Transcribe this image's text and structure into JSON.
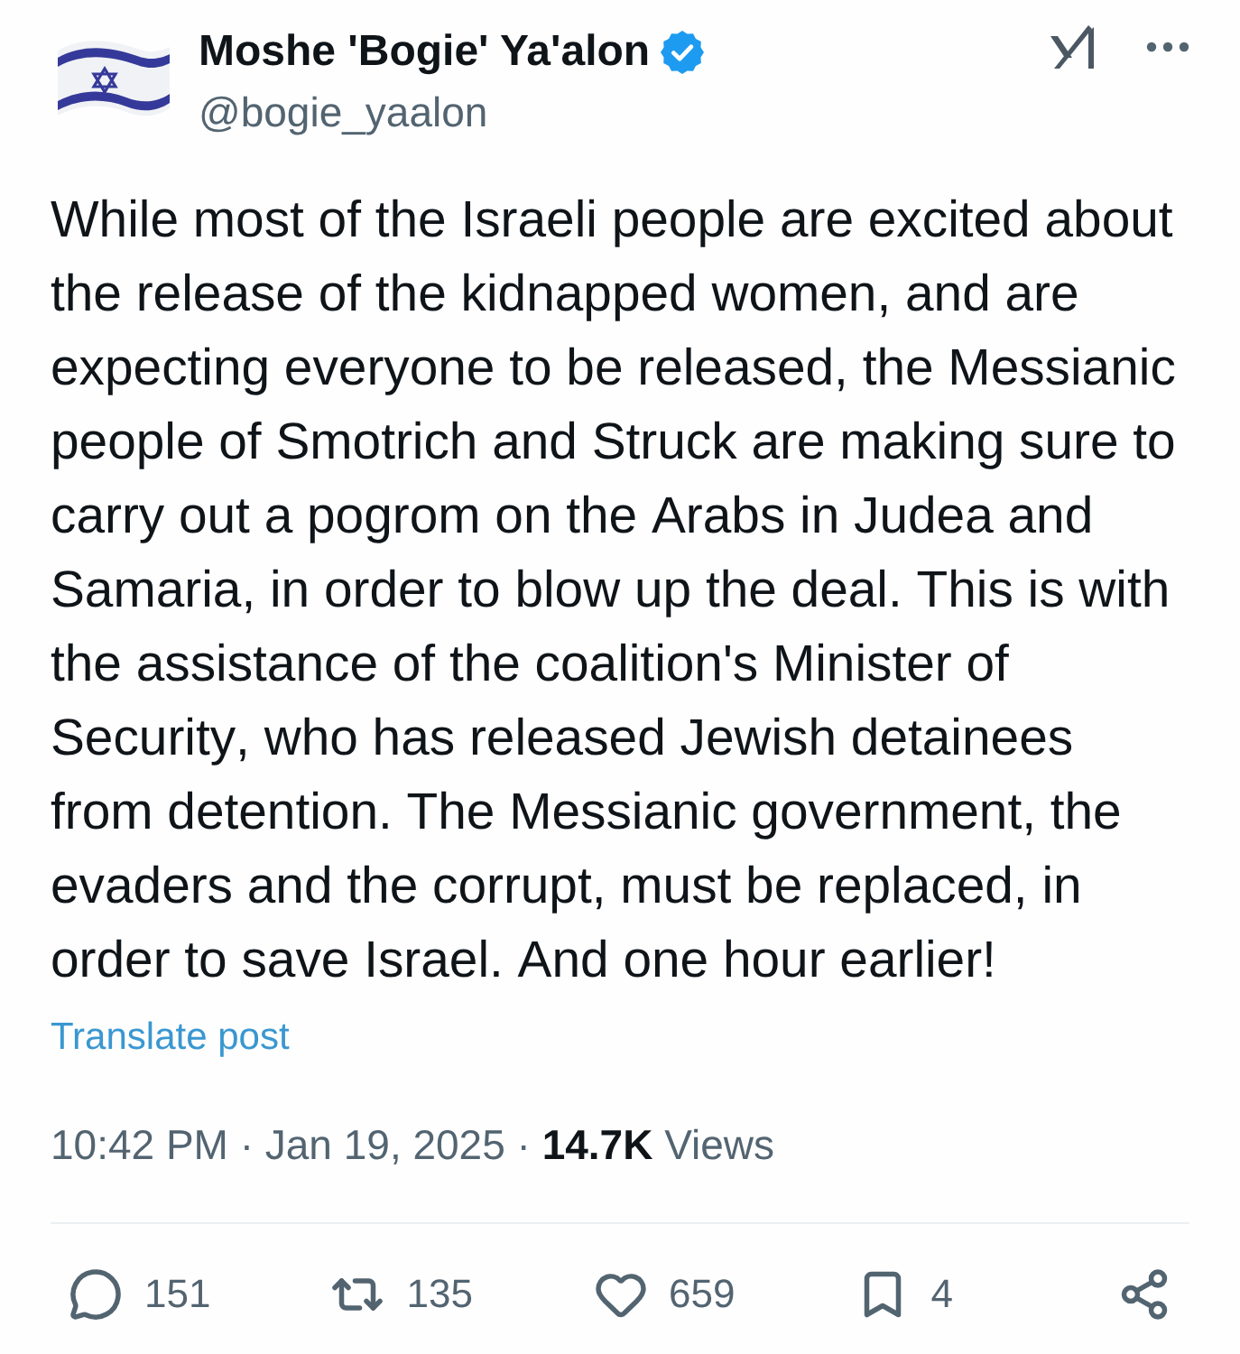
{
  "author": {
    "name": "Moshe 'Bogie' Ya'alon",
    "verified": true,
    "handle": "@bogie_yaalon"
  },
  "post": {
    "text": "While most of the Israeli people are excited about the release of the kidnapped women, and are expecting everyone to be released, the Messianic people of Smotrich and Struck are making sure to carry out a pogrom on the Arabs in Judea and Samaria, in order to blow up the deal. This is with the assistance of the coalition's Minister of Security, who has released Jewish detainees from detention. The Messianic government, the evaders and the corrupt, must be replaced, in order to save Israel. And one hour earlier!",
    "translate_link": "Translate post"
  },
  "meta": "10:42 PM · Jan 19, 2025 · **14.7K** Views",
  "actions": [
    {
      "kind": "reply",
      "count": "151"
    },
    {
      "kind": "repost",
      "count": "135"
    },
    {
      "kind": "like",
      "count": "659"
    },
    {
      "kind": "bookmark",
      "count": "4"
    },
    {
      "kind": "share"
    }
  ]
}
